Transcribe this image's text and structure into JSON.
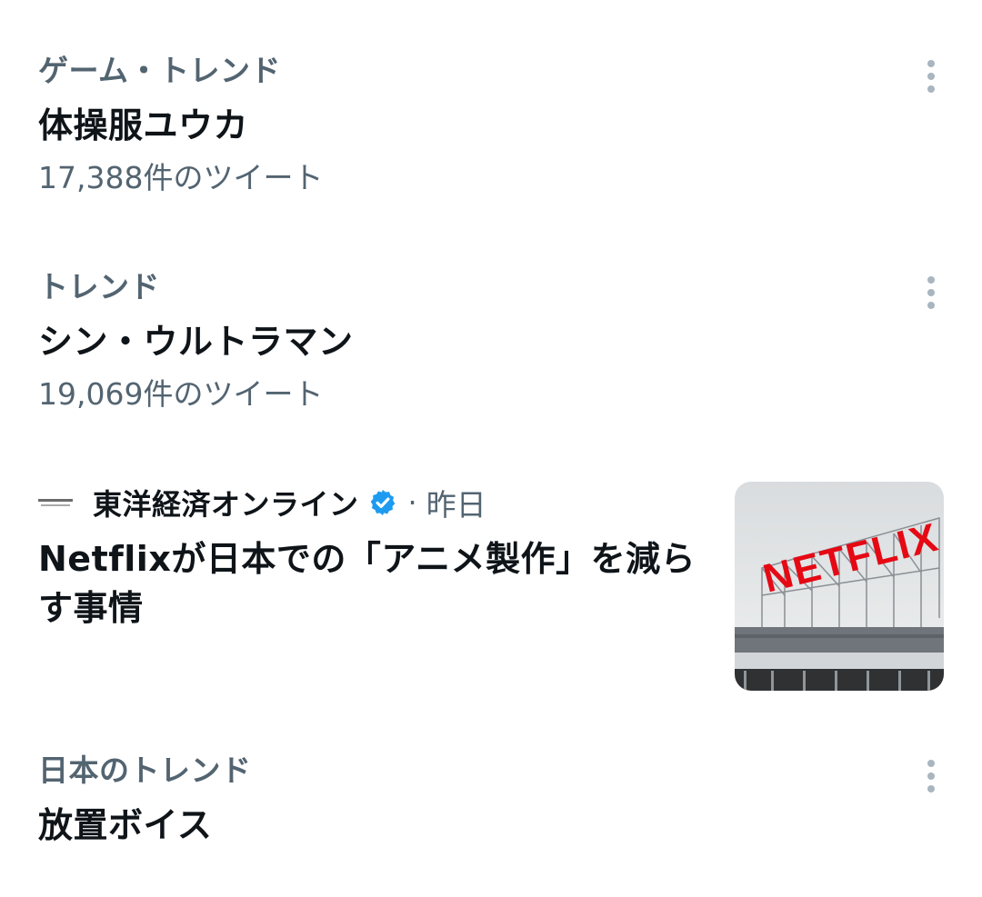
{
  "trends": [
    {
      "context": "ゲーム・トレンド",
      "title": "体操服ユウカ",
      "count": "17,388件のツイート"
    },
    {
      "context": "トレンド",
      "title": "シン・ウルトラマン",
      "count": "19,069件のツイート"
    },
    {
      "context": "日本のトレンド",
      "title": "放置ボイス"
    }
  ],
  "news": {
    "publisher": "東洋経済オンライン",
    "separator": "·",
    "time": "昨日",
    "headline": "Netflixが日本での「アニメ製作」を減らす事情",
    "thumbnail_sign": "NETFLIX"
  },
  "icons": {
    "more": "more-vertical-icon",
    "verified": "verified-badge-icon",
    "publisher_logo": "publisher-logo-icon"
  },
  "colors": {
    "primary_text": "#0f1419",
    "secondary_text": "#536471",
    "verified_blue": "#1d9bf0",
    "netflix_red": "#e50914"
  }
}
